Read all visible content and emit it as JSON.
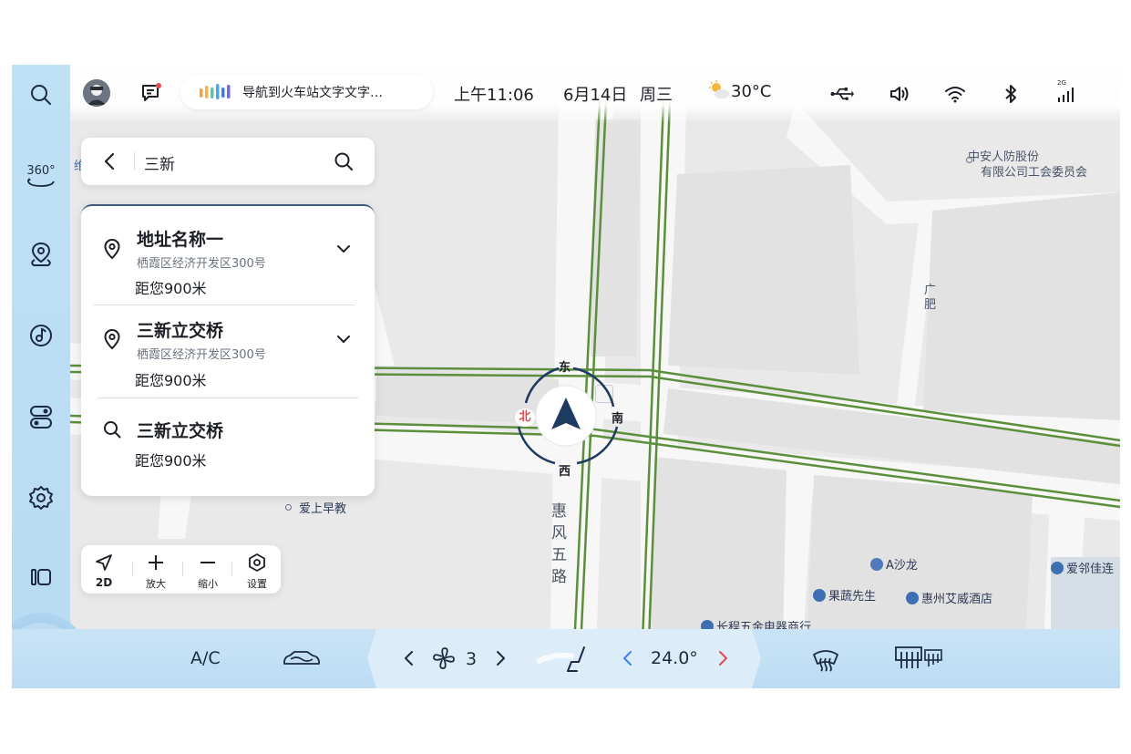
{
  "sidebar": {
    "items": [
      {
        "name": "search",
        "icon": "search-icon"
      },
      {
        "name": "360",
        "icon": "camera-360-icon",
        "label": "360°"
      },
      {
        "name": "navigation",
        "icon": "map-pin-icon"
      },
      {
        "name": "music",
        "icon": "music-note-icon"
      },
      {
        "name": "toggles",
        "icon": "toggle-switch-icon"
      },
      {
        "name": "settings",
        "icon": "gear-icon"
      },
      {
        "name": "apps",
        "icon": "apps-icon"
      }
    ],
    "home_icon": "home-icon"
  },
  "topbar": {
    "voice_text": "导航到火车站文字文字…",
    "time": "上午11:06",
    "date": "6月14日",
    "weekday": "周三",
    "temperature": "30°C",
    "weather_icon": "partly-sunny-icon",
    "status_icons": [
      "usb-icon",
      "volume-icon",
      "wifi-icon",
      "bluetooth-icon",
      "signal-icon"
    ],
    "signal_label": "2G"
  },
  "search": {
    "query": "三新"
  },
  "results": [
    {
      "title": "地址名称一",
      "address": "栖霞区经济开发区300号",
      "distance": "距您900米",
      "icon": "location-pin-icon",
      "expandable": true
    },
    {
      "title": "三新立交桥",
      "address": "栖霞区经济开发区300号",
      "distance": "距您900米",
      "icon": "location-pin-icon",
      "expandable": true
    },
    {
      "title": "三新立交桥",
      "distance": "距您900米",
      "icon": "search-icon",
      "expandable": false
    }
  ],
  "map": {
    "labels": {
      "org_line1": "中安人防股份",
      "org_line2": "有限公司工会委员会",
      "breakfast": "爱上早教",
      "road": [
        "惠",
        "风",
        "五",
        "路"
      ],
      "a_shalong": "A沙龙",
      "guoshu": "果蔬先生",
      "hotel": "惠州艾威酒店",
      "aolin": "爱邻佳连",
      "changcheng": "长程五金电器商行",
      "guang": "广",
      "fei": "肥",
      "left_partial": "维"
    },
    "compass": {
      "north": "北",
      "east": "东",
      "south": "南",
      "west": "西"
    },
    "road_color": "#5b8f3b"
  },
  "map_controls": {
    "view_mode": "2D",
    "zoom_in": "放大",
    "zoom_out": "缩小",
    "settings": "设置"
  },
  "bottombar": {
    "ac": "A/C",
    "fan_level": "3",
    "temperature": "24.0°",
    "icons": [
      "car-air-icon",
      "fan-icon",
      "seat-heat-icon",
      "front-defrost-icon",
      "rear-defrost-icon"
    ]
  },
  "colors": {
    "sidebar_bg": "#bcdcf3",
    "accent_blue": "#3b82f6",
    "alert_red": "#e5484d",
    "nav_arrow": "#1f3a5f"
  }
}
